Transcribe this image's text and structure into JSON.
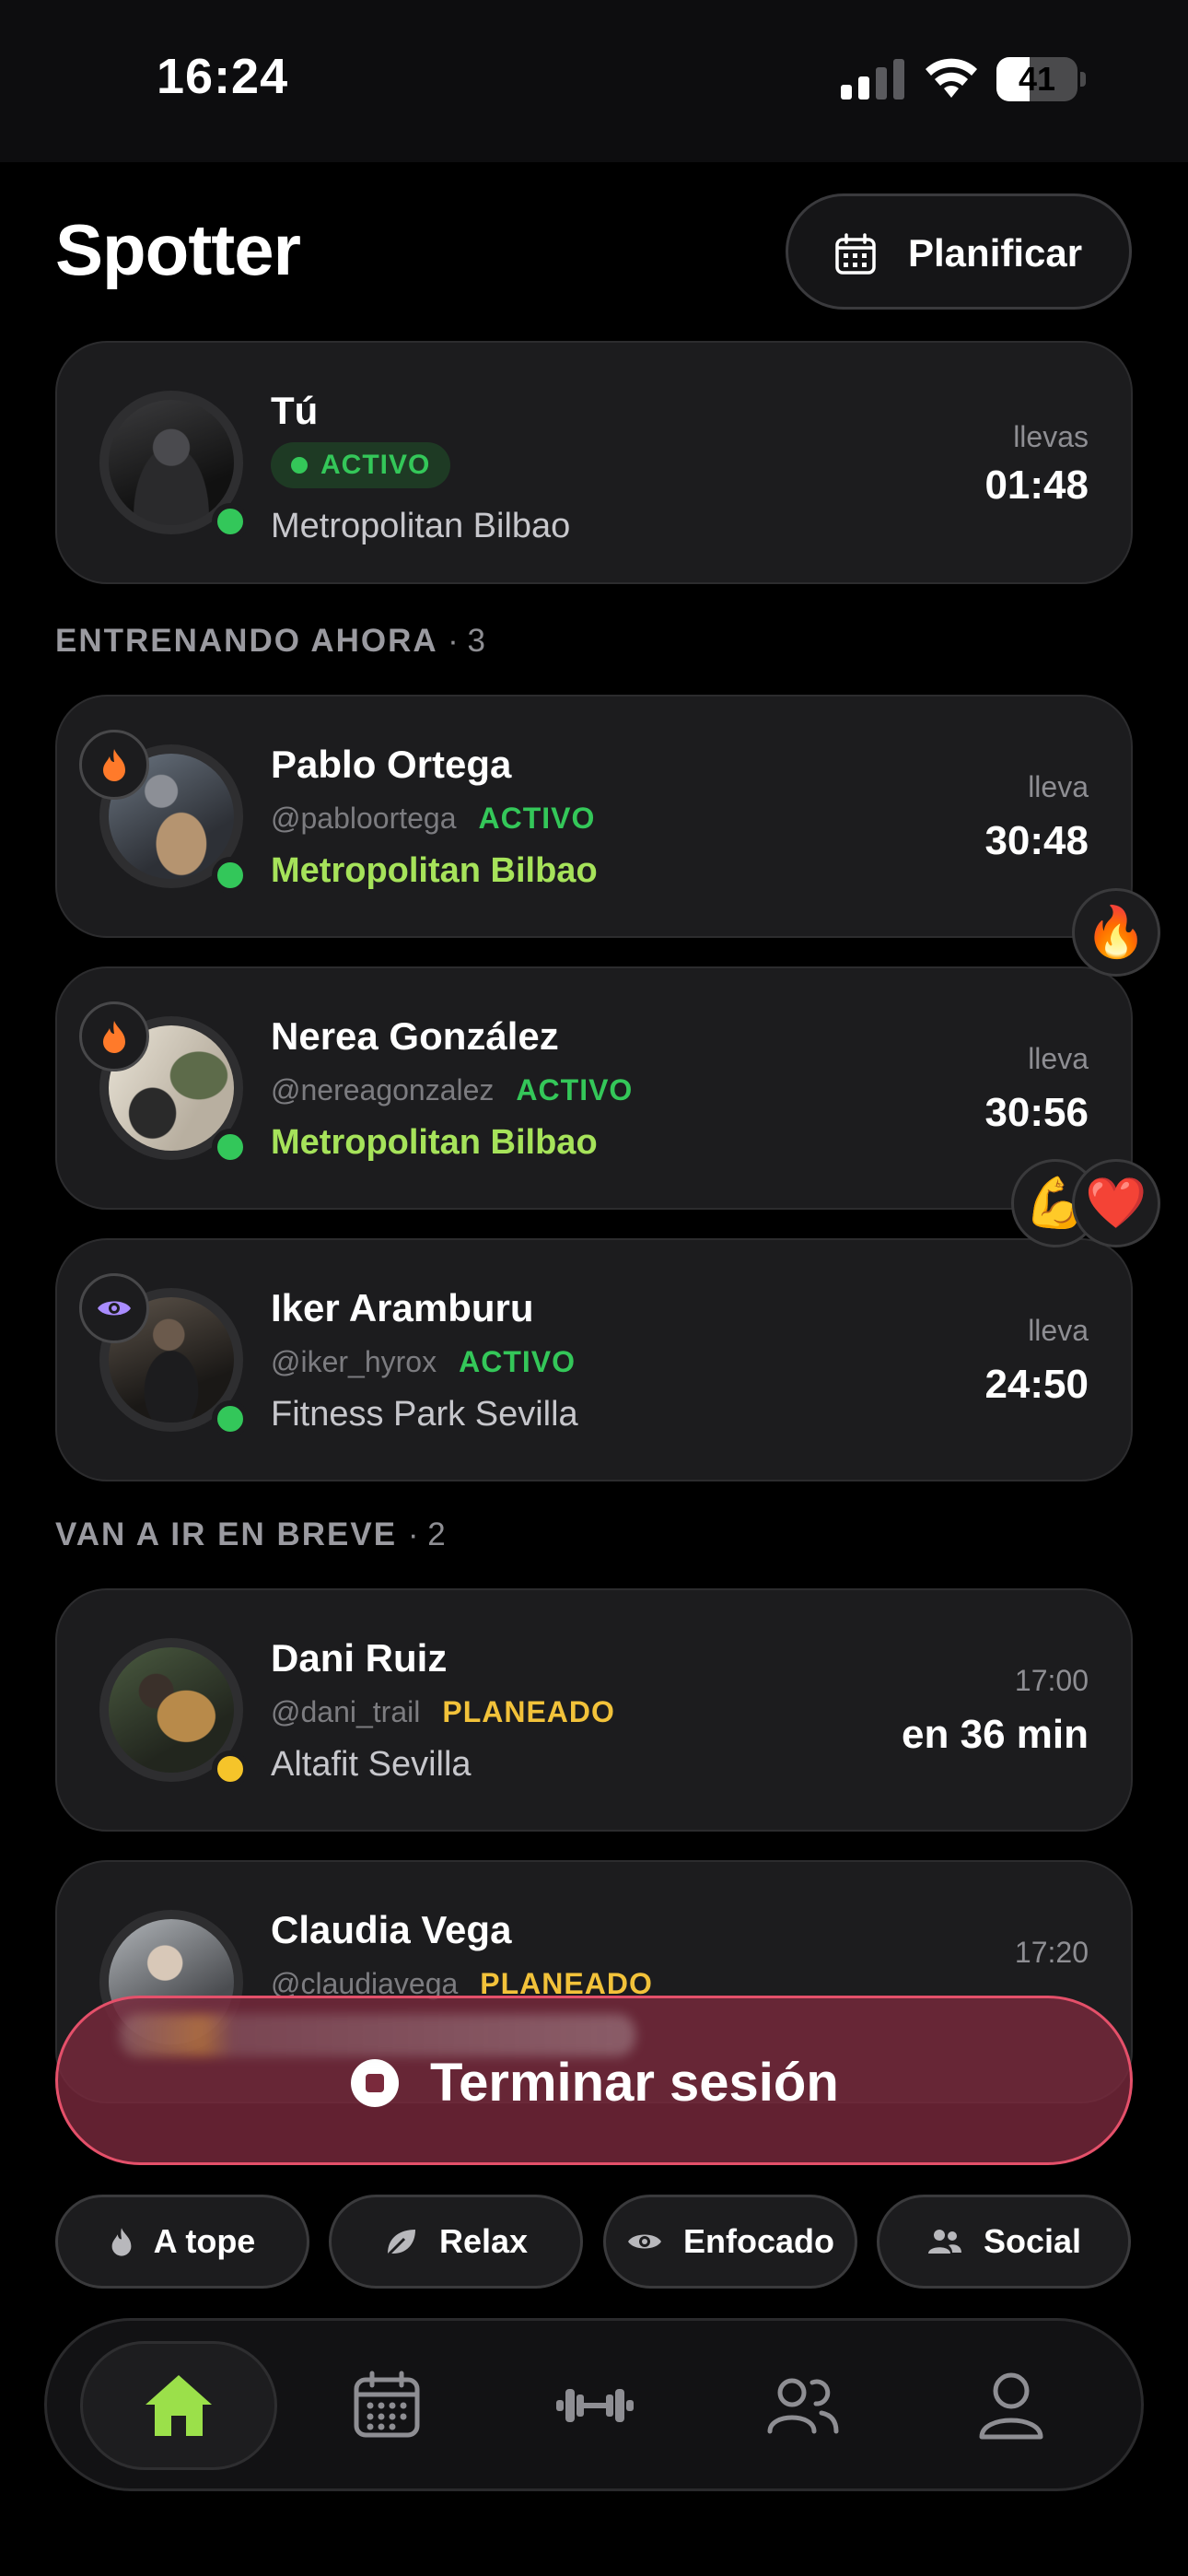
{
  "status_bar": {
    "time": "16:24",
    "battery": "41",
    "battery_level": 0.41
  },
  "header": {
    "title": "Spotter",
    "plan_button": "Planificar"
  },
  "me": {
    "name": "Tú",
    "status": "ACTIVO",
    "gym": "Metropolitan Bilbao",
    "time_label": "llevas",
    "time_value": "01:48"
  },
  "training_now": {
    "label": "ENTRENANDO AHORA",
    "count": "· 3",
    "people": [
      {
        "name": "Pablo Ortega",
        "handle": "@pabloortega",
        "status": "ACTIVO",
        "gym": "Metropolitan Bilbao",
        "time_label": "lleva",
        "time_value": "30:48",
        "mood_icon": "flame-icon"
      },
      {
        "name": "Nerea González",
        "handle": "@nereagonzalez",
        "status": "ACTIVO",
        "gym": "Metropolitan Bilbao",
        "time_label": "lleva",
        "time_value": "30:56",
        "mood_icon": "flame-icon"
      },
      {
        "name": "Iker Aramburu",
        "handle": "@iker_hyrox",
        "status": "ACTIVO",
        "gym": "Fitness Park Sevilla",
        "time_label": "lleva",
        "time_value": "24:50",
        "mood_icon": "eye-icon"
      }
    ]
  },
  "reactions": {
    "pablo": "🔥",
    "nerea_1": "💪",
    "nerea_2": "❤️"
  },
  "coming_soon": {
    "label": "VAN A IR EN BREVE",
    "count": "· 2",
    "people": [
      {
        "name": "Dani Ruiz",
        "handle": "@dani_trail",
        "status": "PLANEADO",
        "gym": "Altafit Sevilla",
        "time_label": "17:00",
        "time_value": "en 36 min"
      },
      {
        "name": "Claudia Vega",
        "handle": "@claudiavega",
        "status": "PLANEADO",
        "time_label": "17:20"
      }
    ]
  },
  "end_session": "Terminar sesión",
  "moods": [
    "A tope",
    "Relax",
    "Enfocado",
    "Social"
  ],
  "tabs": [
    "home-tab",
    "calendar-tab",
    "workout-tab",
    "friends-tab",
    "profile-tab"
  ],
  "colors": {
    "active": "#34c759",
    "planned": "#f2c23a",
    "highlight_gym": "#a6e35a",
    "end_button": "#e5506a"
  }
}
